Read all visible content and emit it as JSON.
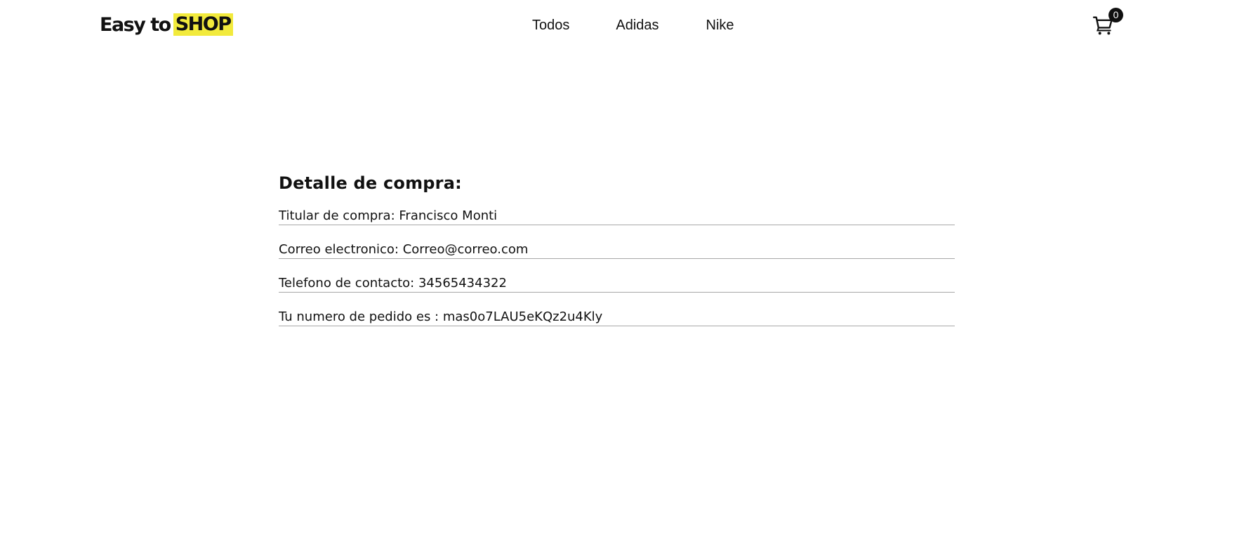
{
  "header": {
    "logo": {
      "part1": "Easy to",
      "part2": "SHOP",
      "highlight_color": "#f2ea3c"
    },
    "nav": {
      "items": [
        {
          "label": "Todos"
        },
        {
          "label": "Adidas"
        },
        {
          "label": "Nike"
        }
      ]
    },
    "cart": {
      "icon": "shopping-cart-icon",
      "count": "0"
    }
  },
  "main": {
    "title": "Detalle de compra:",
    "rows": [
      {
        "label": "Titular de compra:",
        "value": "Francisco Monti"
      },
      {
        "label": "Correo electronico:",
        "value": "Correo@correo.com"
      },
      {
        "label": "Telefono de contacto:",
        "value": "34565434322"
      },
      {
        "label": "Tu numero de pedido es :",
        "value": "mas0o7LAU5eKQz2u4Kly"
      }
    ]
  }
}
